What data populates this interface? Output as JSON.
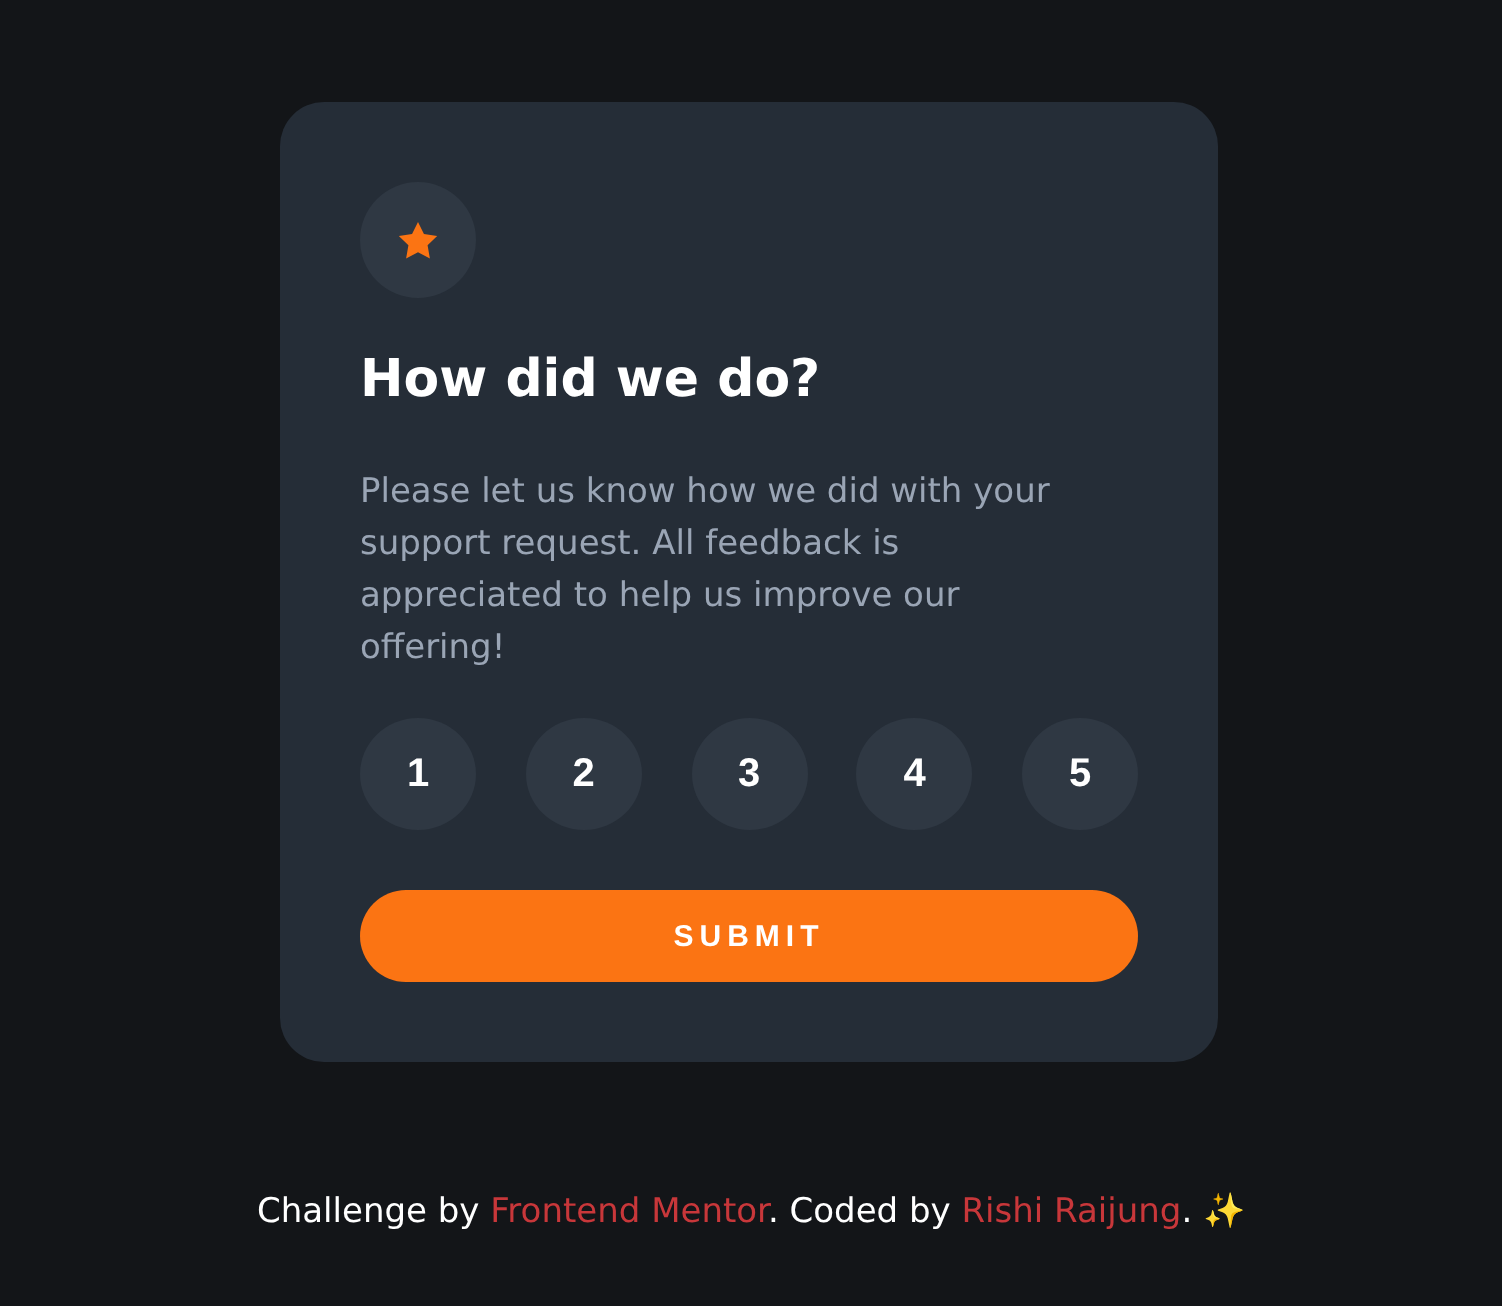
{
  "card": {
    "title": "How did we do?",
    "description": "Please let us know how we did with your support request. All feedback is appreciated to help us improve our offering!",
    "ratings": [
      {
        "label": "1",
        "selected": false
      },
      {
        "label": "2",
        "selected": false
      },
      {
        "label": "3",
        "selected": false
      },
      {
        "label": "4",
        "selected": false
      },
      {
        "label": "5",
        "selected": false
      }
    ],
    "submit": "SUBMIT"
  },
  "footer": [
    {
      "kind": "text",
      "text": "Challenge by "
    },
    {
      "kind": "link",
      "text": "Frontend Mentor"
    },
    {
      "kind": "text",
      "text": ". Coded by "
    },
    {
      "kind": "link",
      "text": "Rishi Raijung"
    },
    {
      "kind": "text",
      "text": ". ✨"
    }
  ]
}
